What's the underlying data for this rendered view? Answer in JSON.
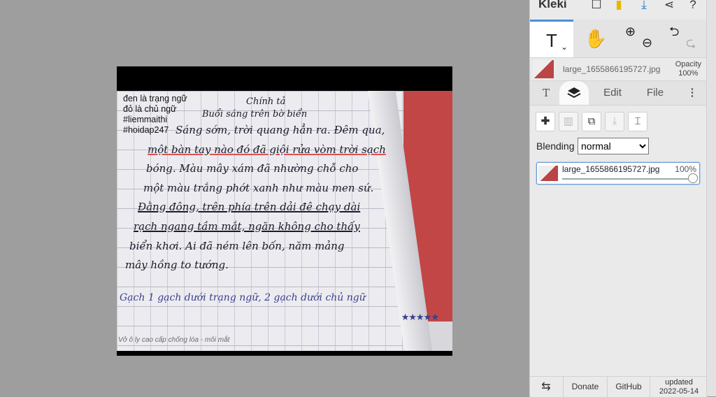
{
  "app": {
    "name": "Kleki",
    "accent": "#4a90d9"
  },
  "toolbar": {
    "tools": [
      "text-tool",
      "hand-tool",
      "zoom-tool",
      "undo-redo"
    ],
    "active_tool": "text-tool",
    "text_icon": "T",
    "text_caret": "⌄",
    "hand_icon": "✋",
    "zoom_in": "⊕",
    "zoom_out": "⊖",
    "undo": "⮌",
    "redo": "⮎"
  },
  "layer_row": {
    "name": "large_1655866195727.jpg",
    "opacity_label": "Opacity",
    "opacity_value": "100%"
  },
  "tabs": {
    "text": "T",
    "layers": "layers",
    "edit": "Edit",
    "file": "File",
    "more": "⋮"
  },
  "layer_tools": [
    "add-layer",
    "delete-layer",
    "duplicate-layer",
    "merge-layer",
    "rename-layer"
  ],
  "blending": {
    "label": "Blending",
    "selected": "normal"
  },
  "layer_card": {
    "name": "large_1655866195727.jpg",
    "opacity": "100%",
    "opacity_fraction": 1.0
  },
  "bottom": {
    "swap_icon": "⇆",
    "donate": "Donate",
    "github": "GitHub",
    "updated_label": "updated",
    "updated_date": "2022-05-14"
  },
  "image": {
    "notes": [
      "đen là trạng ngữ",
      "đỏ là chủ ngữ",
      "#liemmaithi",
      "#hoidap247"
    ],
    "title": "Chính tả",
    "subtitle": "Buổi sáng trên bờ biển",
    "lines": [
      "Sáng sớm, trời quang hẳn ra. Đêm qua,",
      "một bàn tay nào đó đã giội rửa vòm trời sạch",
      "bóng. Màu mây xám đã nhường chỗ cho",
      "một màu trắng phớt xanh như màu men sứ.",
      "Đằng đông, trên phía trên dải đê chạy dài",
      "rạch ngang tầm mắt, ngăn không cho thấy",
      "biển khơi. Ai đã ném lên bốn, năm mảng",
      "mây hồng to tướng."
    ],
    "blue_note": "Gạch 1 gạch dưới trạng ngữ, 2 gạch dưới chủ ngữ",
    "stars": "★★★★★",
    "footer": "Vở ô ly cao cấp chống lóa - môi mắt"
  }
}
